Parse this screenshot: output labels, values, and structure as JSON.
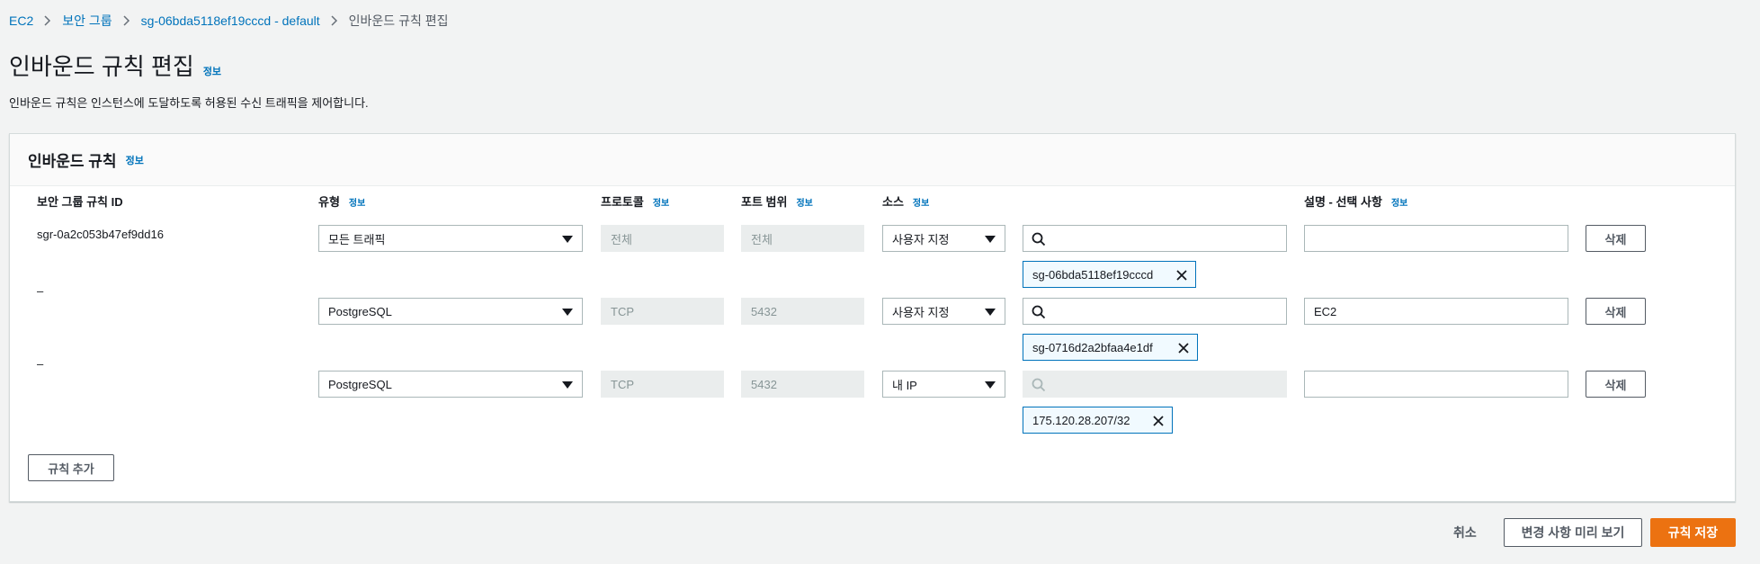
{
  "breadcrumb": {
    "items": [
      "EC2",
      "보안 그룹",
      "sg-06bda5118ef19cccd - default"
    ],
    "current": "인바운드 규칙 편집"
  },
  "page": {
    "title": "인바운드 규칙 편집",
    "info": "정보",
    "description": "인바운드 규칙은 인스턴스에 도달하도록 허용된 수신 트래픽을 제어합니다."
  },
  "panel": {
    "title": "인바운드 규칙",
    "info": "정보",
    "columns": {
      "rule_id": "보안 그룹 규칙 ID",
      "type": "유형",
      "protocol": "프로토콜",
      "port_range": "포트 범위",
      "source": "소스",
      "description": "설명 - 선택 사항",
      "info": "정보"
    },
    "rows": [
      {
        "rule_id": "sgr-0a2c053b47ef9dd16",
        "type": "모든 트래픽",
        "protocol": "전체",
        "port_range": "전체",
        "source": "사용자 지정",
        "search_value": "",
        "token": "sg-06bda5118ef19cccd",
        "description": "",
        "delete": "삭제"
      },
      {
        "rule_id": "–",
        "type": "PostgreSQL",
        "protocol": "TCP",
        "port_range": "5432",
        "source": "사용자 지정",
        "search_value": "",
        "token": "sg-0716d2a2bfaa4e1df",
        "description": "EC2",
        "delete": "삭제"
      },
      {
        "rule_id": "–",
        "type": "PostgreSQL",
        "protocol": "TCP",
        "port_range": "5432",
        "source": "내 IP",
        "search_value": "",
        "token": "175.120.28.207/32",
        "description": "",
        "delete": "삭제"
      }
    ],
    "add_rule": "규칙 추가"
  },
  "footer": {
    "cancel": "취소",
    "preview": "변경 사항 미리 보기",
    "save": "규칙 저장"
  },
  "colors": {
    "link": "#0073bb",
    "primary_button": "#ec7211",
    "token_border": "#0073bb",
    "background": "#f2f3f3"
  }
}
